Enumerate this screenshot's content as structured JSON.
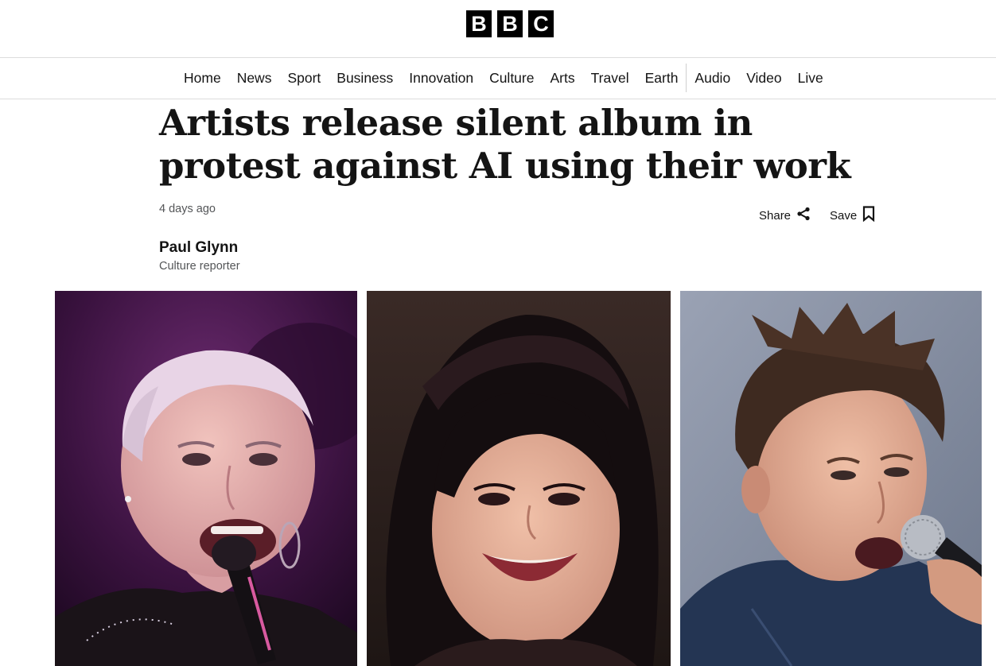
{
  "header": {
    "logo_letters": [
      "B",
      "B",
      "C"
    ]
  },
  "nav": {
    "primary": [
      "Home",
      "News",
      "Sport",
      "Business",
      "Innovation",
      "Culture",
      "Arts",
      "Travel",
      "Earth"
    ],
    "secondary": [
      "Audio",
      "Video",
      "Live"
    ]
  },
  "article": {
    "headline": "Artists release silent album in protest against AI using their work",
    "timestamp": "4 days ago",
    "share_label": "Share",
    "save_label": "Save",
    "author_name": "Paul Glynn",
    "author_role": "Culture reporter"
  },
  "icons": {
    "share": "share-icon",
    "save": "bookmark-icon"
  },
  "colors": {
    "brand": "#000000",
    "text": "#141414",
    "muted": "#545658"
  }
}
